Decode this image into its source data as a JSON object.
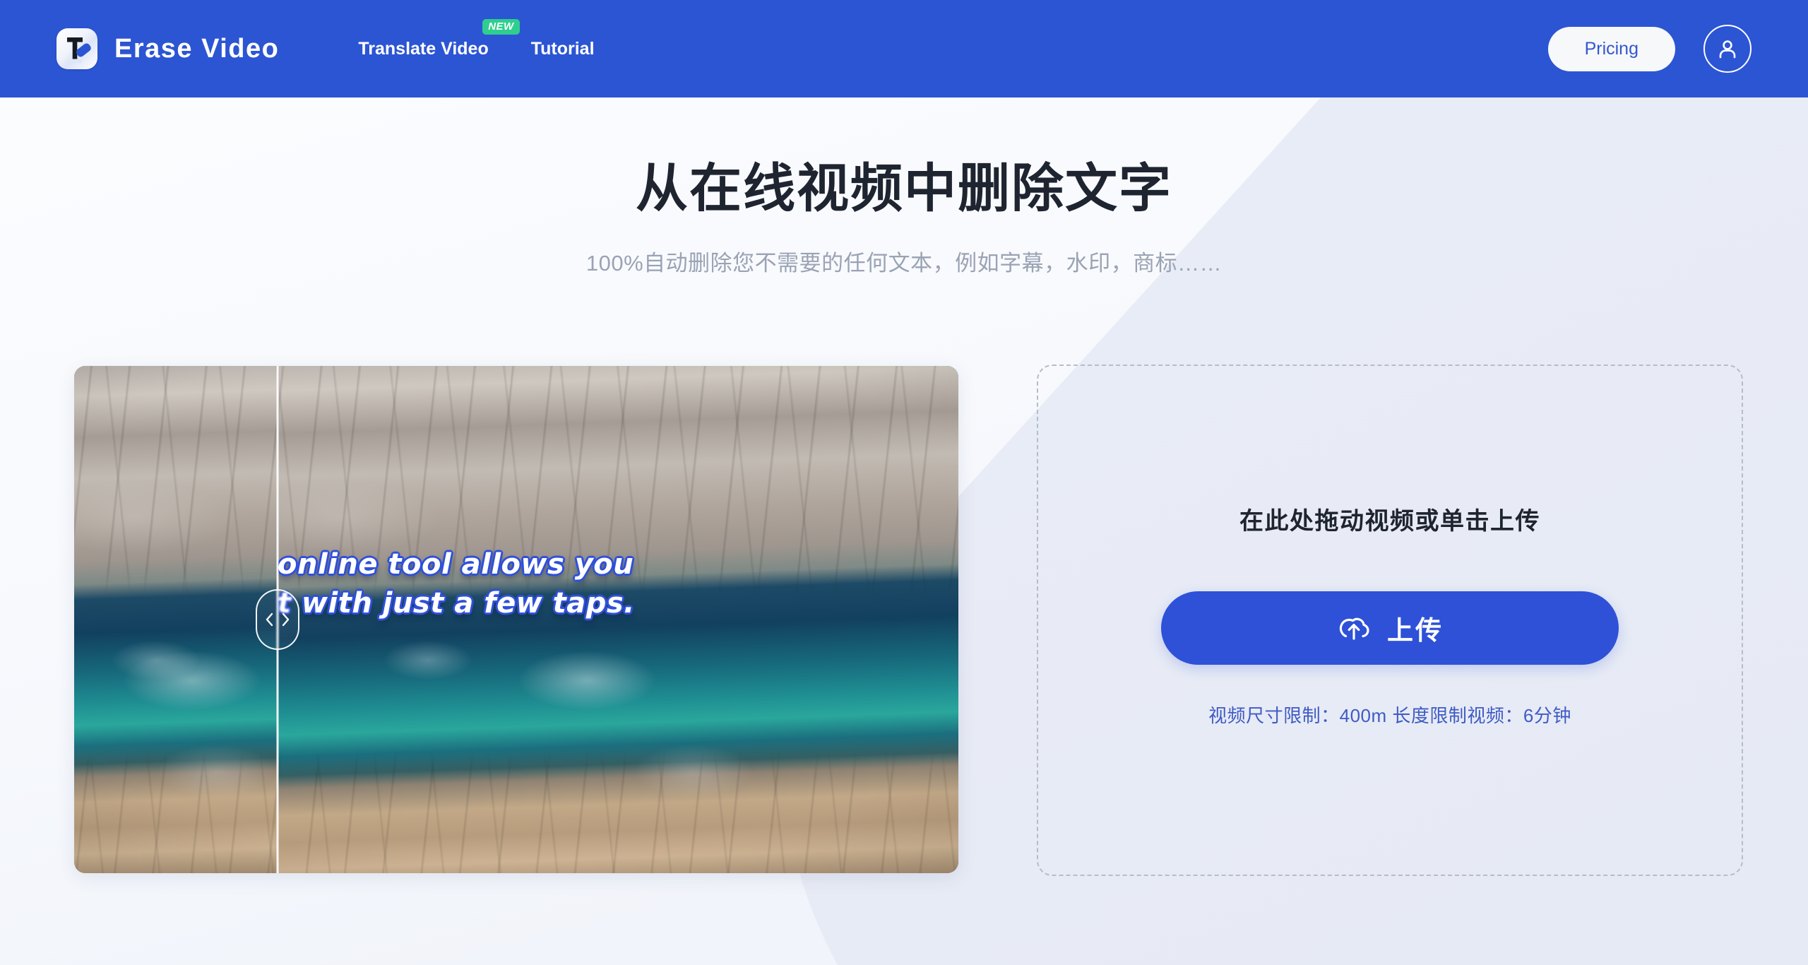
{
  "brand": {
    "name": "Erase Video",
    "logo_icon": "text-eraser-icon"
  },
  "header": {
    "background_color": "#2c55d4",
    "nav": [
      {
        "label": "Translate Video",
        "badge": "NEW",
        "badge_color": "#2fce8e"
      },
      {
        "label": "Tutorial",
        "badge": null
      }
    ],
    "pricing_label": "Pricing",
    "account_icon": "user-circle-icon"
  },
  "hero": {
    "title": "从在线视频中删除文字",
    "subtitle": "100%自动删除您不需要的任何文本，例如字幕，水印，商标……"
  },
  "preview": {
    "slider_handle_icons": [
      "chevron-left-icon",
      "chevron-right-icon"
    ],
    "caption_line1": "online tool allows you",
    "caption_line2": "t with just a few taps.",
    "caption_outline_color": "#2f50d8"
  },
  "upload": {
    "title": "在此处拖动视频或单击上传",
    "button_label": "上传",
    "button_icon": "cloud-upload-icon",
    "button_color": "#2e51d8",
    "note": "视频尺寸限制：400m  长度限制视频：6分钟",
    "note_color": "#3f5bc4"
  },
  "colors": {
    "page_light": "#f8f9fc",
    "page_tint": "#e9ecf6",
    "accent": "#2c55d4",
    "heading": "#1e2430",
    "muted": "#9aa3b4"
  }
}
